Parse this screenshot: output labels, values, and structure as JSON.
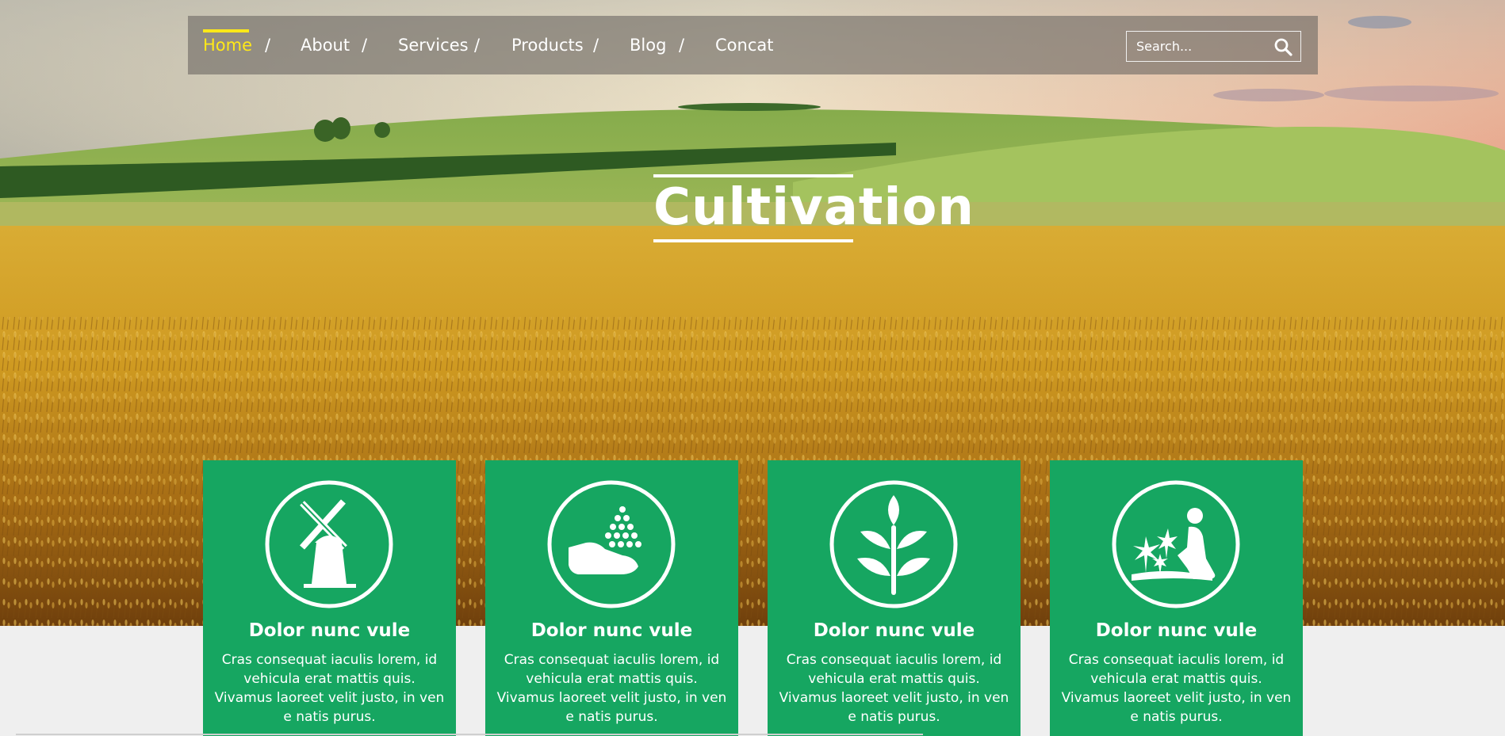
{
  "nav": {
    "items": [
      {
        "label": "Home",
        "active": true
      },
      {
        "label": "About",
        "active": false
      },
      {
        "label": "Services",
        "active": false
      },
      {
        "label": "Products",
        "active": false
      },
      {
        "label": "Blog",
        "active": false
      },
      {
        "label": "Concat",
        "active": false
      }
    ],
    "separator": "/",
    "active_color": "#ffe818"
  },
  "search": {
    "placeholder": "Search...",
    "icon": "search-icon"
  },
  "hero": {
    "title": "Cultivation"
  },
  "cards": [
    {
      "icon": "windmill-icon",
      "title": "Dolor nunc vule",
      "text": "Cras consequat iaculis lorem, id vehicula erat mattis quis. Vivamus laoreet velit justo, in ven e natis purus."
    },
    {
      "icon": "hand-seeds-icon",
      "title": "Dolor nunc vule",
      "text": "Cras consequat iaculis lorem, id vehicula erat mattis quis. Vivamus laoreet velit justo, in ven e natis purus."
    },
    {
      "icon": "sprout-icon",
      "title": "Dolor nunc vule",
      "text": "Cras consequat iaculis lorem, id vehicula erat mattis quis. Vivamus laoreet velit justo, in ven e natis purus."
    },
    {
      "icon": "gardener-icon",
      "title": "Dolor nunc vule",
      "text": "Cras consequat iaculis lorem, id vehicula erat mattis quis. Vivamus laoreet velit justo, in ven e natis purus."
    }
  ],
  "colors": {
    "card_green": "#16a661",
    "page_bg": "#efefef"
  }
}
